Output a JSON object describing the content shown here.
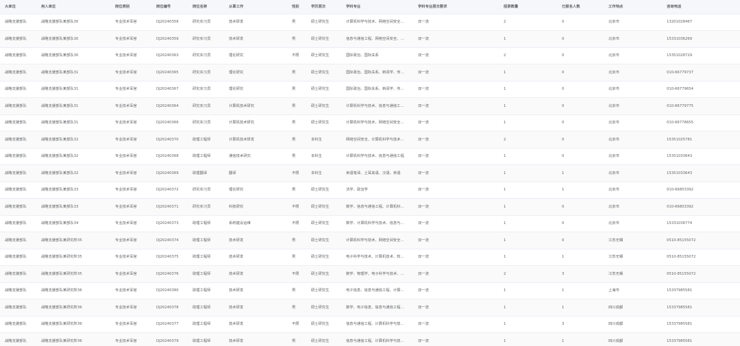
{
  "table": {
    "columns": [
      "大单位",
      "用人单位",
      "岗位类别",
      "岗位编号",
      "岗位名称",
      "从事工作",
      "性别",
      "学历层次",
      "学科专业",
      "学科专业层次要求",
      "招录数量",
      "已报名人数",
      "工作地点",
      "咨询电话"
    ],
    "rows": [
      [
        "战略支援部队",
        "战略支援部队某部队30",
        "专业技术军官",
        "DJ20240358",
        "研究实习员",
        "技术研发",
        "男",
        "硕士研究生",
        "计算机科学与技术、网络空间安全…",
        "双一流",
        "2",
        "0",
        "北京市",
        "13201028467"
      ],
      [
        "战略支援部队",
        "战略支援部队某部队30",
        "专业技术军官",
        "DJ20240359",
        "研究实习员",
        "技术研发",
        "男",
        "硕士研究生",
        "信息与通信工程、网络空间安全、…",
        "双一流",
        "1",
        "0",
        "北京市",
        "15331036269"
      ],
      [
        "战略支援部队",
        "战略支援部队某部队30",
        "专业技术军官",
        "DJ20240363",
        "研究实习员",
        "理论研究",
        "不限",
        "硕士研究生",
        "国际政治、国际关系",
        "双一流",
        "2",
        "0",
        "北京市",
        "15351028729"
      ],
      [
        "战略支援部队",
        "战略支援部队某部队31",
        "专业技术军官",
        "DJ20240365",
        "研究实习员",
        "理论研究",
        "男",
        "硕士研究生",
        "国际政治、国际关系、新闻学、传…",
        "双一流",
        "1",
        "0",
        "北京市",
        "010-66779737"
      ],
      [
        "战略支援部队",
        "战略支援部队某部队31",
        "专业技术军官",
        "DJ20240367",
        "研究实习员",
        "理论研究",
        "男",
        "硕士研究生",
        "国际政治、国际关系、新闻学、传…",
        "双一流",
        "1",
        "0",
        "北京市",
        "010-66779654"
      ],
      [
        "战略支援部队",
        "战略支援部队某部队31",
        "专业技术军官",
        "DJ20240364",
        "研究实习员",
        "计算机技术研究",
        "男",
        "硕士研究生",
        "计算机科学与技术、信息与通信工…",
        "双一流",
        "1",
        "0",
        "北京市",
        "010-66779775"
      ],
      [
        "战略支援部队",
        "战略支援部队某部队31",
        "专业技术军官",
        "DJ20240366",
        "研究实习员",
        "计算机技术研究",
        "男",
        "硕士研究生",
        "计算机科学与技术、网络空间安全…",
        "双一流",
        "1",
        "0",
        "北京市",
        "010-66778655"
      ],
      [
        "战略支援部队",
        "战略支援部队某部队32",
        "专业技术军官",
        "DJ20240370",
        "助理工程师",
        "计算机技术研发",
        "男",
        "本科生",
        "网络空间安全、计算机科学与技术…",
        "双一流",
        "2",
        "0",
        "北京市",
        "15351025781"
      ],
      [
        "战略支援部队",
        "战略支援部队某部队32",
        "专业技术军官",
        "DJ20240368",
        "助理工程师",
        "通信技术研究",
        "男",
        "本科生",
        "计算机科学与技术、信息与通信工程",
        "双一流",
        "1",
        "0",
        "北京市",
        "15351033643"
      ],
      [
        "战略支援部队",
        "战略支援部队某部队32",
        "专业技术军官",
        "DJ20240369",
        "助理翻译",
        "翻译",
        "不限",
        "本科生",
        "英语笔译、土耳其语、汉语、英语",
        "双一流",
        "1",
        "1",
        "北京市",
        "15351033643"
      ],
      [
        "战略支援部队",
        "战略支援部队某部队33",
        "专业技术军官",
        "DJ20240372",
        "研究实习员",
        "理论研究",
        "男",
        "硕士研究生",
        "法学、政治学",
        "双一流",
        "1",
        "1",
        "北京市",
        "010-66803392"
      ],
      [
        "战略支援部队",
        "战略支援部队某部队33",
        "专业技术军官",
        "DJ20240371",
        "研究实习员",
        "科技研究",
        "不限",
        "硕士研究生",
        "数学、信息与通信工程、计算机科…",
        "双一流",
        "1",
        "0",
        "北京市",
        "010-66803392"
      ],
      [
        "战略支援部队",
        "战略支援部队某部队34",
        "专业技术军官",
        "DJ20240373",
        "助理工程师",
        "系统建设运维",
        "不限",
        "硕士研究生",
        "数学、计算机科学与技术、信息与…",
        "双一流",
        "1",
        "0",
        "北京市",
        "15331036774"
      ],
      [
        "战略支援部队",
        "战略支援部队某研究所35",
        "专业技术军官",
        "DJ20240374",
        "助理工程师",
        "技术研发",
        "男",
        "硕士研究生",
        "计算机科学与技术、网络空间安全…",
        "双一流",
        "1",
        "0",
        "江苏无锡",
        "0510-85155072"
      ],
      [
        "战略支援部队",
        "战略支援部队某研究所35",
        "专业技术军官",
        "DJ20240375",
        "助理工程师",
        "技术研发",
        "男",
        "硕士研究生",
        "电子科学与技术、计算机技术、软…",
        "双一流",
        "1",
        "1",
        "江苏无锡",
        "0510-85155072"
      ],
      [
        "战略支援部队",
        "战略支援部队某研究所35",
        "专业技术军官",
        "DJ20240376",
        "助理工程师",
        "技术研发",
        "不限",
        "硕士研究生",
        "数学、物理学、电子科学与技术、…",
        "双一流",
        "2",
        "3",
        "江苏无锡",
        "0510-85155072"
      ],
      [
        "战略支援部队",
        "战略支援部队某研究所36",
        "专业技术军官",
        "DJ20240380",
        "助理工程师",
        "技术研发",
        "男",
        "硕士研究生",
        "电子信息、信息与通信工程、计算…",
        "双一流",
        "1",
        "1",
        "上海市",
        "15337985581"
      ],
      [
        "战略支援部队",
        "战略支援部队某研究所36",
        "专业技术军官",
        "DJ20240378",
        "助理工程师",
        "技术研发",
        "男",
        "硕士研究生",
        "数学、电子信息、信息与通信工程…",
        "双一流",
        "1",
        "1",
        "四川成都",
        "15337985581"
      ],
      [
        "战略支援部队",
        "战略支援部队某研究所36",
        "专业技术军官",
        "DJ20240377",
        "助理工程师",
        "技术研发",
        "不限",
        "硕士研究生",
        "信息与通信工程、计算机科学与技…",
        "双一流",
        "1",
        "3",
        "四川成都",
        "15337985581"
      ],
      [
        "战略支援部队",
        "战略支援部队某研究所36",
        "专业技术军官",
        "DJ20240379",
        "助理工程师",
        "技术研发",
        "男",
        "硕士研究生",
        "信息与通信工程、计算机科学与技…",
        "双一流",
        "1",
        "1",
        "四川成都",
        "15337985581"
      ]
    ]
  }
}
